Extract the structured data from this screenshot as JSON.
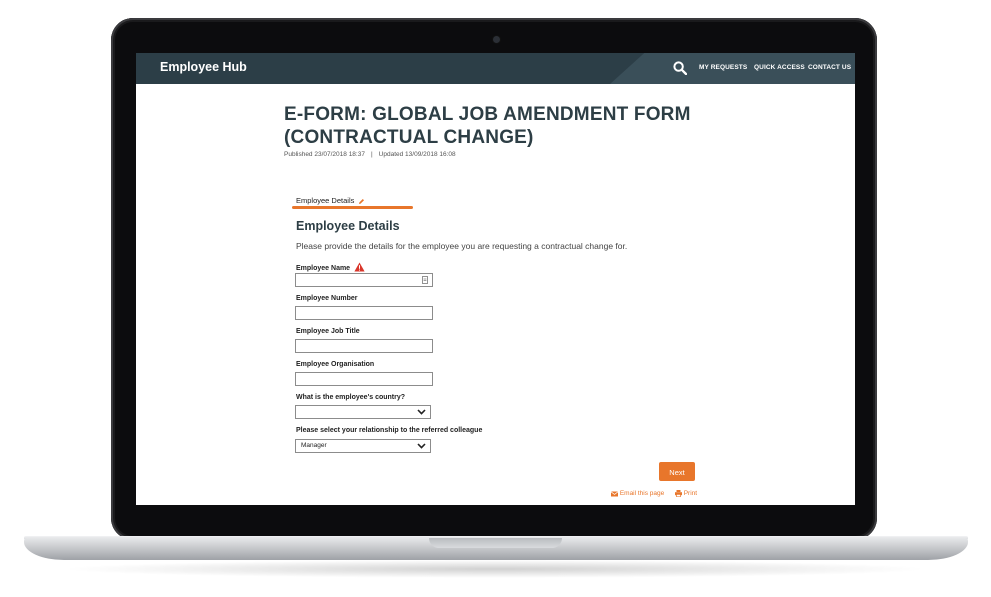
{
  "header": {
    "brand": "Employee Hub",
    "nav": [
      "MY REQUESTS",
      "QUICK ACCESS",
      "CONTACT US"
    ]
  },
  "page": {
    "title": "E-FORM: GLOBAL JOB AMENDMENT FORM (CONTRACTUAL CHANGE)",
    "published": "Published 23/07/2018 18:37",
    "separator": "|",
    "updated": "Updated 13/09/2018 16:08"
  },
  "steps": {
    "current": "Employee Details"
  },
  "form": {
    "section_title": "Employee Details",
    "description": "Please provide the details for the employee you are requesting a contractual change for.",
    "fields": [
      {
        "label": "Employee Name",
        "value": ""
      },
      {
        "label": "Employee Number",
        "value": ""
      },
      {
        "label": "Employee Job Title",
        "value": ""
      },
      {
        "label": "Employee Organisation",
        "value": ""
      }
    ],
    "country_label": "What is the employee's country?",
    "country_value": "",
    "relationship_label": "Please select your relationship to the referred colleague",
    "relationship_value": "Manager",
    "next_label": "Next"
  },
  "footer": {
    "email_label": "Email this page",
    "print_label": "Print"
  },
  "colors": {
    "header_bg": "#2c3e47",
    "accent": "#e8762b",
    "title": "#2d3e45",
    "warning": "#d9362b"
  }
}
